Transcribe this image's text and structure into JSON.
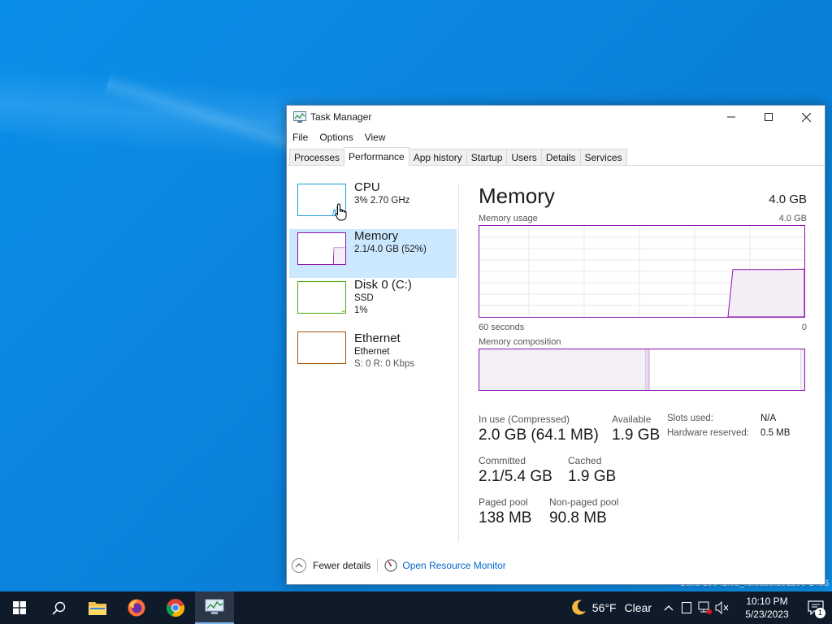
{
  "window": {
    "title": "Task Manager",
    "menu": [
      "File",
      "Options",
      "View"
    ],
    "tabs": [
      "Processes",
      "Performance",
      "App history",
      "Startup",
      "Users",
      "Details",
      "Services"
    ],
    "active_tab": "Performance"
  },
  "sidebar": {
    "items": [
      {
        "name": "CPU",
        "line1": "3%  2.70 GHz",
        "line2": "",
        "color": "#1d9bd1"
      },
      {
        "name": "Memory",
        "line1": "2.1/4.0 GB (52%)",
        "line2": "",
        "color": "#8b12ae"
      },
      {
        "name": "Disk 0 (C:)",
        "line1": "SSD",
        "line2": "1%",
        "color": "#4da60c"
      },
      {
        "name": "Ethernet",
        "line1": "Ethernet",
        "line2": "S: 0  R: 0 Kbps",
        "color": "#a74f01"
      }
    ]
  },
  "main": {
    "heading": "Memory",
    "total": "4.0 GB",
    "usage_label": "Memory usage",
    "usage_max": "4.0 GB",
    "axis_left": "60 seconds",
    "axis_right": "0",
    "composition_label": "Memory composition",
    "usage_fraction": 0.52,
    "stats": {
      "in_use_label": "In use (Compressed)",
      "in_use_value": "2.0 GB (64.1 MB)",
      "available_label": "Available",
      "available_value": "1.9 GB",
      "committed_label": "Committed",
      "committed_value": "2.1/5.4 GB",
      "cached_label": "Cached",
      "cached_value": "1.9 GB",
      "paged_label": "Paged pool",
      "paged_value": "138 MB",
      "nonpaged_label": "Non-paged pool",
      "nonpaged_value": "90.8 MB",
      "slots_label": "Slots used:",
      "slots_value": "N/A",
      "hw_label": "Hardware reserved:",
      "hw_value": "0.5 MB"
    }
  },
  "footer": {
    "fewer_details": "Fewer details",
    "resource_monitor": "Open Resource Monitor"
  },
  "taskbar": {
    "weather_temp": "56°F",
    "weather_cond": "Clear",
    "time": "10:10 PM",
    "date": "5/23/2023",
    "notification_count": "1"
  },
  "desktop": {
    "watermark": "Build 19041.vb_release.191206-1406"
  },
  "colors": {
    "accent": "#8b12ae",
    "selection": "#cce8ff",
    "link": "#0066cc",
    "taskbar": "#101b2a"
  }
}
